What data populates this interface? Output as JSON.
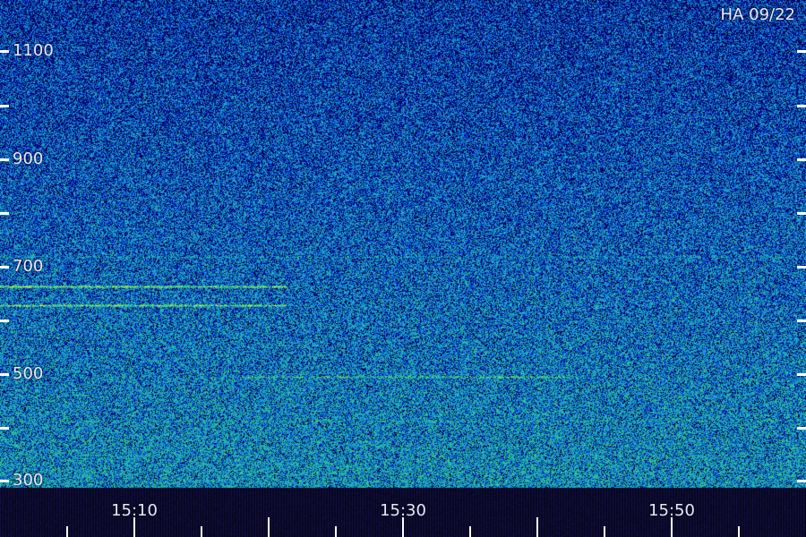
{
  "corner_label": "HA 09/22",
  "y_axis": {
    "tick_labels": [
      "1100",
      "900",
      "700",
      "500",
      "300"
    ]
  },
  "x_axis": {
    "tick_labels": [
      "15:10",
      "15:30",
      "15:50"
    ]
  },
  "colors": {
    "background_blue": "#1d2fb0",
    "noise_cyan": "#35c8c8",
    "signal_yellow": "#d8e020",
    "axis_bar": "#120f3a",
    "tick": "#ffffff"
  }
}
